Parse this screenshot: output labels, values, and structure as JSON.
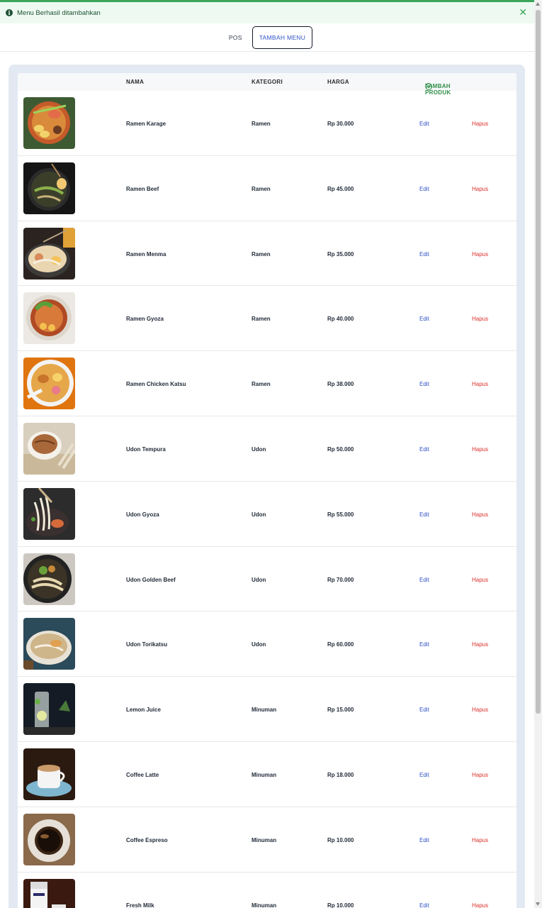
{
  "alert": {
    "message": "Menu Berhasil ditambahkan"
  },
  "tabs": [
    {
      "label": "POS"
    },
    {
      "label": "TAMBAH MENU"
    }
  ],
  "table": {
    "headers": {
      "nama": "NAMA",
      "kategori": "KATEGORI",
      "harga": "HARGA"
    },
    "add_button_label": "TAMBAH PRODUK",
    "edit_label": "Edit",
    "delete_label": "Hapus",
    "rows": [
      {
        "nama": "Ramen Karage",
        "kategori": "Ramen",
        "harga": "Rp 30.000"
      },
      {
        "nama": "Ramen Beef",
        "kategori": "Ramen",
        "harga": "Rp 45.000"
      },
      {
        "nama": "Ramen Menma",
        "kategori": "Ramen",
        "harga": "Rp 35.000"
      },
      {
        "nama": "Ramen Gyoza",
        "kategori": "Ramen",
        "harga": "Rp 40.000"
      },
      {
        "nama": "Ramen Chicken Katsu",
        "kategori": "Ramen",
        "harga": "Rp 38.000"
      },
      {
        "nama": "Udon Tempura",
        "kategori": "Udon",
        "harga": "Rp 50.000"
      },
      {
        "nama": "Udon Gyoza",
        "kategori": "Udon",
        "harga": "Rp 55.000"
      },
      {
        "nama": "Udon Golden Beef",
        "kategori": "Udon",
        "harga": "Rp 70.000"
      },
      {
        "nama": "Udon Torikatsu",
        "kategori": "Udon",
        "harga": "Rp 60.000"
      },
      {
        "nama": "Lemon Juice",
        "kategori": "Minuman",
        "harga": "Rp 15.000"
      },
      {
        "nama": "Coffee Latte",
        "kategori": "Minuman",
        "harga": "Rp 18.000"
      },
      {
        "nama": "Coffee Espreso",
        "kategori": "Minuman",
        "harga": "Rp 10.000"
      },
      {
        "nama": "Fresh Milk",
        "kategori": "Minuman",
        "harga": "Rp 10.000"
      }
    ]
  },
  "colors": {
    "accent": "#2f54c8",
    "success": "#2f8f47",
    "danger": "#d9302c",
    "alert_bg": "#eefaf1",
    "panel_bg": "#e3e9f2"
  }
}
